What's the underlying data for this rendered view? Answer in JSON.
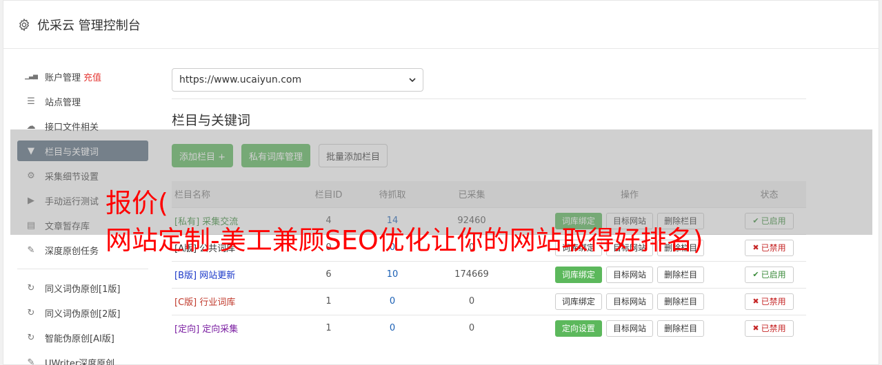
{
  "header": {
    "title": "优采云 管理控制台",
    "icon": "gear-icon"
  },
  "sidebar": {
    "items": [
      {
        "label": "账户管理",
        "icon": "bar-chart-icon",
        "extra": "充值"
      },
      {
        "label": "站点管理",
        "icon": "server-icon"
      },
      {
        "label": "接口文件相关",
        "icon": "cloud-upload-icon"
      },
      {
        "label": "栏目与关键词",
        "icon": "filter-icon",
        "active": true
      },
      {
        "label": "采集细节设置",
        "icon": "gears-icon"
      },
      {
        "label": "手动运行测试",
        "icon": "play-circle-icon"
      },
      {
        "label": "文章暂存库",
        "icon": "database-icon"
      },
      {
        "label": "深度原创任务",
        "icon": "edit-icon"
      }
    ],
    "items2": [
      {
        "label": "同义词伪原创[1版]",
        "icon": "refresh-icon"
      },
      {
        "label": "同义词伪原创[2版]",
        "icon": "refresh-icon"
      },
      {
        "label": "智能伪原创[AI版]",
        "icon": "refresh-icon"
      },
      {
        "label": "UWriter深度原创",
        "icon": "edit-icon"
      }
    ]
  },
  "main": {
    "site_url": "https://www.ucaiyun.com",
    "section_title": "栏目与关键词",
    "add_column": "添加栏目 +",
    "private_lib": "私有词库管理",
    "batch_add": "批量添加栏目",
    "columns": [
      "栏目名称",
      "栏目ID",
      "待抓取",
      "已采集",
      "操作",
      "状态"
    ],
    "rows": [
      {
        "name": "[私有] 采集交流",
        "id": "4",
        "pending": "14",
        "collected": "92460",
        "op1": "词库绑定",
        "op1_green": true,
        "op2": "目标网站",
        "op3": "删除栏目",
        "status": "已启用",
        "enabled": true,
        "color": "#3c8c3c"
      },
      {
        "name": "[A版] 公共词库",
        "id": "0",
        "pending": "0",
        "collected": "0",
        "op1": "词库绑定",
        "op1_green": false,
        "op2": "目标网站",
        "op3": "删除栏目",
        "status": "已禁用",
        "enabled": false,
        "color": "#333333"
      },
      {
        "name": "[B版] 网站更新",
        "id": "6",
        "pending": "10",
        "collected": "174669",
        "op1": "词库绑定",
        "op1_green": true,
        "op2": "目标网站",
        "op3": "删除栏目",
        "status": "已启用",
        "enabled": true,
        "color": "#1a37c8"
      },
      {
        "name": "[C版] 行业词库",
        "id": "1",
        "pending": "0",
        "collected": "0",
        "op1": "词库绑定",
        "op1_green": false,
        "op2": "目标网站",
        "op3": "删除栏目",
        "status": "已禁用",
        "enabled": false,
        "color": "#c0392b"
      },
      {
        "name": "[定向] 定向采集",
        "id": "1",
        "pending": "0",
        "collected": "0",
        "op1": "定向设置",
        "op1_green": true,
        "op2": "目标网站",
        "op3": "删除栏目",
        "status": "已禁用",
        "enabled": false,
        "color": "#7b1fa2"
      }
    ]
  },
  "overlay": {
    "line1": "报价(",
    "line2": "网站定制-美工兼顾SEO优化让你的网站取得好排名)"
  }
}
